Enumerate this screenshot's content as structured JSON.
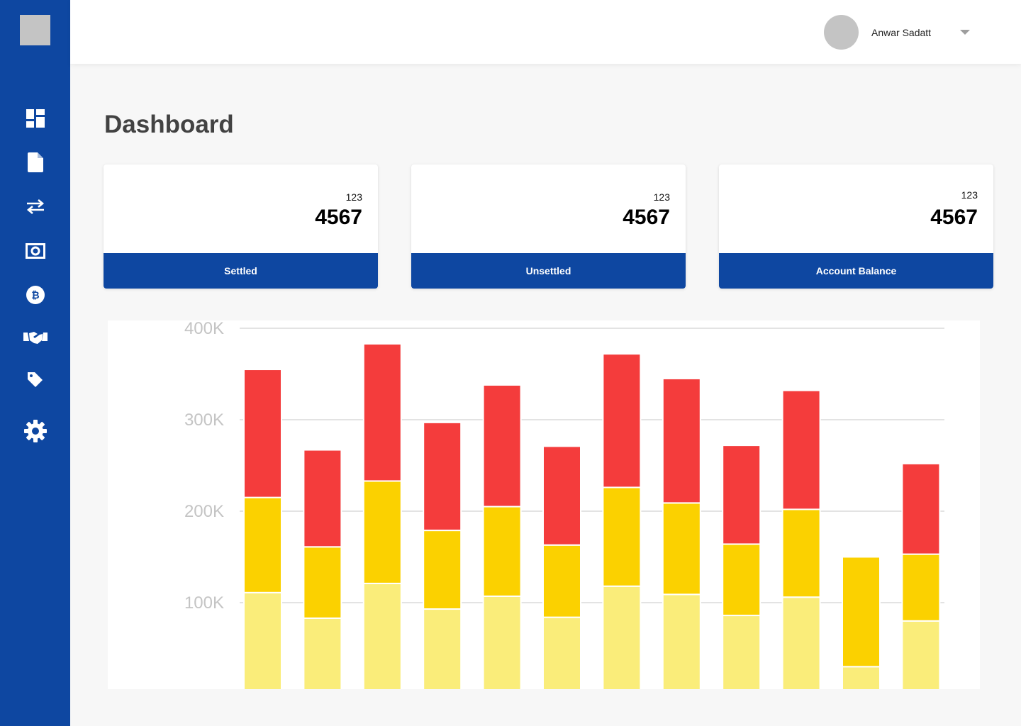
{
  "sidebar": {
    "items": [
      {
        "icon": "dashboard-icon",
        "name": "nav-dashboard"
      },
      {
        "icon": "document-icon",
        "name": "nav-documents"
      },
      {
        "icon": "transfer-arrows-icon",
        "name": "nav-transfers"
      },
      {
        "icon": "money-icon",
        "name": "nav-money"
      },
      {
        "icon": "bitcoin-icon",
        "name": "nav-bitcoin"
      },
      {
        "icon": "handshake-icon",
        "name": "nav-deals"
      },
      {
        "icon": "tag-icon",
        "name": "nav-tags"
      },
      {
        "icon": "gear-icon",
        "name": "nav-settings"
      }
    ]
  },
  "header": {
    "user_name": "Anwar Sadatt"
  },
  "page": {
    "title": "Dashboard"
  },
  "cards": [
    {
      "small": "123",
      "big": "4567",
      "label": "Settled"
    },
    {
      "small": "123",
      "big": "4567",
      "label": "Unsettled"
    },
    {
      "small": "123",
      "big": "4567",
      "label": "Account Balance"
    }
  ],
  "colors": {
    "brand": "#0e47a1",
    "series_light": "#faed7a",
    "series_mid": "#fbd100",
    "series_top": "#f43c3c"
  },
  "chart_data": {
    "type": "bar",
    "stacked": true,
    "title": "",
    "xlabel": "",
    "ylabel": "",
    "ylim": [
      0,
      400000
    ],
    "yticks": [
      "100K",
      "200K",
      "300K",
      "400K"
    ],
    "ytick_values": [
      100000,
      200000,
      300000,
      400000
    ],
    "grid": true,
    "categories": [
      "",
      "",
      "",
      "",
      "",
      "",
      "",
      "",
      "",
      "",
      "",
      ""
    ],
    "series": [
      {
        "color": "#faed7a",
        "values": [
          111000,
          83000,
          121000,
          93000,
          107000,
          84000,
          118000,
          109000,
          86000,
          106000,
          30000,
          80000
        ]
      },
      {
        "color": "#fbd100",
        "values": [
          104000,
          78000,
          112000,
          86000,
          98000,
          79000,
          108000,
          100000,
          78000,
          96000,
          120000,
          73000
        ]
      },
      {
        "color": "#f43c3c",
        "values": [
          140000,
          106000,
          150000,
          118000,
          133000,
          108000,
          146000,
          136000,
          108000,
          130000,
          0,
          99000
        ]
      }
    ]
  }
}
